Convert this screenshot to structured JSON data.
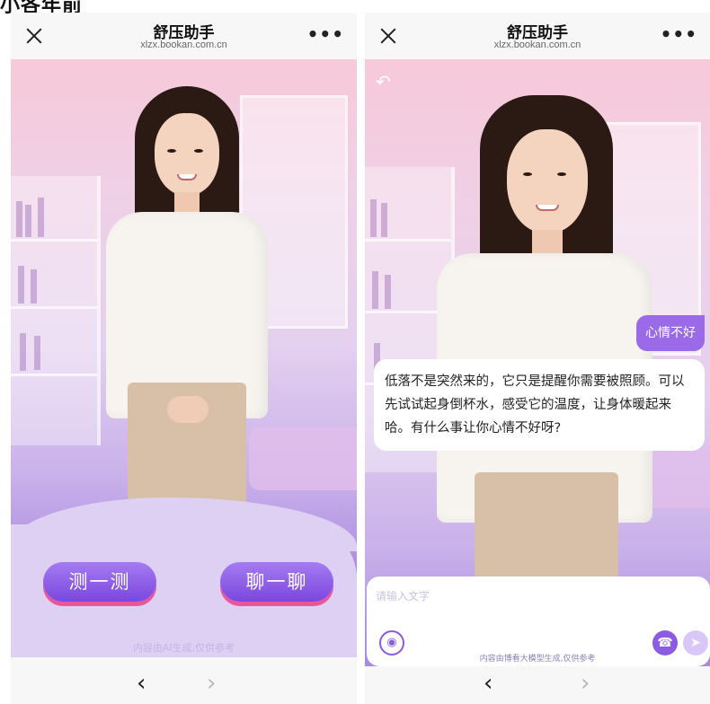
{
  "caption": "小各年前",
  "left": {
    "nav": {
      "title": "舒压助手",
      "url": "xlzx.bookan.com.cn",
      "more": "•••"
    },
    "buttons": {
      "test": "测一测",
      "chat": "聊一聊"
    },
    "disclaimer": "内容由AI生成,仅供参考",
    "toolbar": {
      "back": "‹",
      "forward": "›"
    }
  },
  "right": {
    "nav": {
      "title": "舒压助手",
      "url": "xlzx.bookan.com.cn",
      "more": "•••"
    },
    "user_message": "心情不好",
    "bot_message": "低落不是突然来的，它只是提醒你需要被照顾。可以先试试起身倒杯水，感受它的温度，让身体暖起来哈。有什么事让你心情不好呀?",
    "input_placeholder": "请输入文字",
    "disclaimer": "内容由博看大模型生成,仅供参考",
    "toolbar": {
      "back": "‹",
      "forward": "›"
    }
  },
  "icons": {
    "close": "close-icon",
    "more": "more-icon",
    "undo": "undo-icon",
    "voice": "voice-icon",
    "phone": "phone-icon",
    "send": "send-icon"
  },
  "colors": {
    "accent": "#8d5ae6",
    "button_shadow": "#e9569b",
    "user_bubble": "#9a6ae8"
  }
}
